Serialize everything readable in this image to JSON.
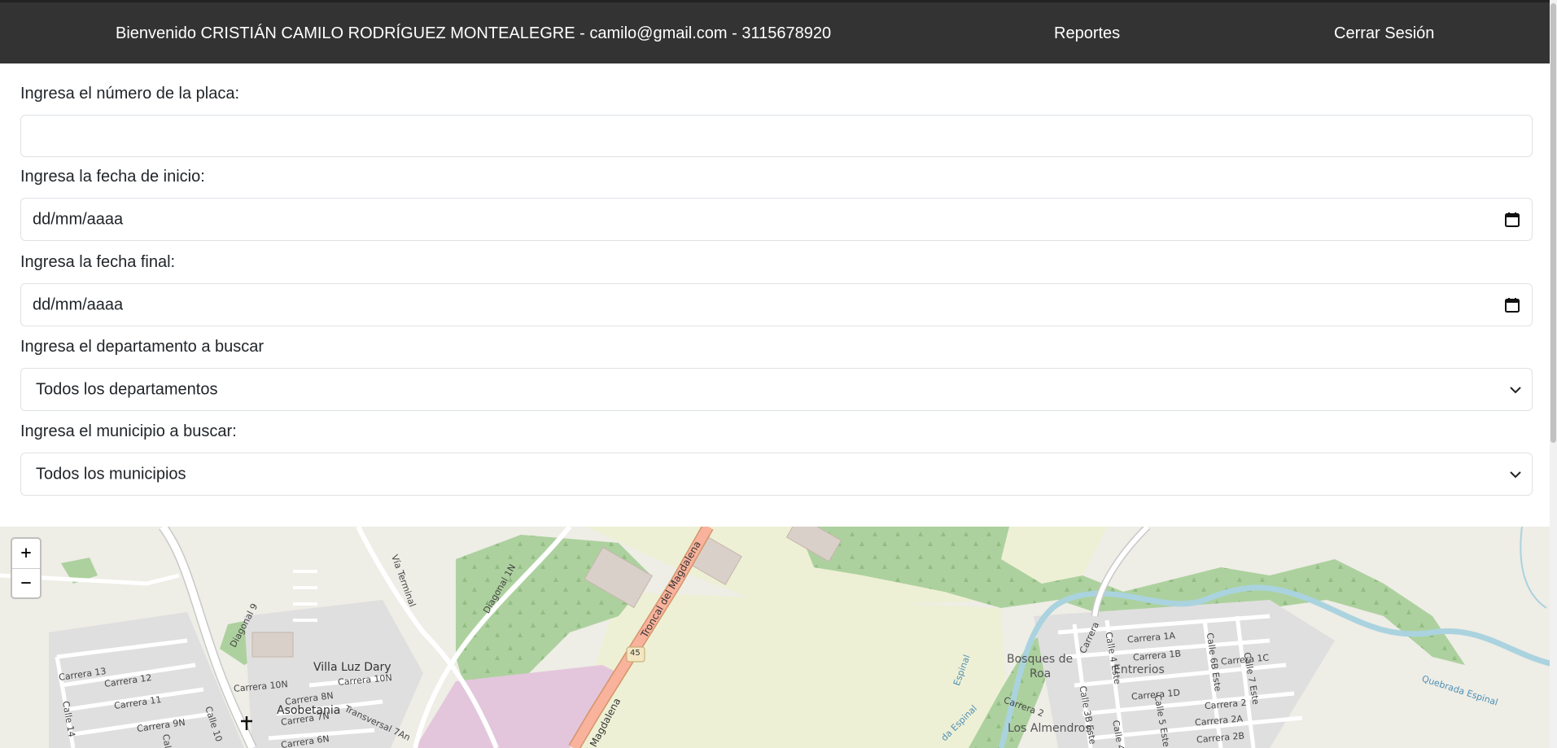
{
  "header": {
    "welcome": "Bienvenido CRISTIÁN CAMILO RODRÍGUEZ MONTEALEGRE - camilo@gmail.com - 3115678920",
    "reportes": "Reportes",
    "logout": "Cerrar Sesión"
  },
  "form": {
    "plate_label": "Ingresa el número de la placa:",
    "plate_value": "",
    "start_label": "Ingresa la fecha de inicio:",
    "start_placeholder": "dd/mm/aaaa",
    "end_label": "Ingresa la fecha final:",
    "end_placeholder": "dd/mm/aaaa",
    "department_label": "Ingresa el departamento a buscar",
    "department_selected": "Todos los departamentos",
    "municipality_label": "Ingresa el municipio a buscar:",
    "municipality_selected": "Todos los municipios"
  },
  "map": {
    "zoom_in": "+",
    "zoom_out": "−",
    "labels": {
      "via_terminal": "Vía Terminal",
      "diagonal_1n": "Diagonal 1N",
      "troncal": "Troncal del Magdalena",
      "troncal_lower": "al Magdalena",
      "route_45": "45",
      "diagonal_9": "Diagonal 9",
      "carrera_13": "Carrera 13",
      "carrera_12": "Carrera 12",
      "carrera_11": "Carrera 11",
      "carrera_9n": "Carrera 9N",
      "calle_14": "Calle 14",
      "calle_10": "Calle 10",
      "calle_lower": "Calle",
      "carrera_10n_a": "Carrera 10N",
      "carrera_10n_b": "Carrera 10N",
      "villa_luz_dary": "Villa Luz Dary",
      "carrera_8n": "Carrera 8N",
      "carrera_7n": "Carrera 7N",
      "carrera_6n": "Carrera 6N",
      "asobetania": "Asobetania",
      "transversal_7an": "Transversal 7An",
      "bosques_de": "Bosques de",
      "roa": "Roa",
      "carrera_1a": "Carrera 1A",
      "carrera_1b": "Carrera 1B",
      "carrera_1c": "Carrera 1C",
      "carrera_1d": "Carrera 1D",
      "carrera_2": "Carrera 2",
      "carrera_2_b": "Carrera 2",
      "carrera_2a": "Carrera 2A",
      "carrera_2b": "Carrera 2B",
      "carrera_top": "Carrera",
      "entrerios": "Entrerios",
      "los_almendros": "Los Almendros",
      "calle_4_este": "Calle 4 Este",
      "calle_3b_este": "Calle 3B Este",
      "calle_4": "Calle 4",
      "calle_5_este": "Calle 5 Este",
      "calle_6b_este": "Calle 6B Este",
      "calle_7_este": "Calle 7 Este",
      "quebrada_espinal": "Quebrada Espinal",
      "espinal_a": "da Espinal",
      "espinal_b": "Espinal"
    },
    "colors": {
      "land": "#eeede6",
      "forest": "#add19e",
      "park": "#c8e6b0",
      "water": "#aad3df",
      "road": "#ffffff",
      "trunk": "#f9b29c",
      "residential_area": "#e0dfdf",
      "commercial": "#e3c6dc",
      "building": "#d9d0c9"
    }
  },
  "colors": {
    "topbar_bg": "#333333",
    "topbar_text": "#ffffff",
    "field_border": "#dee2e6"
  }
}
